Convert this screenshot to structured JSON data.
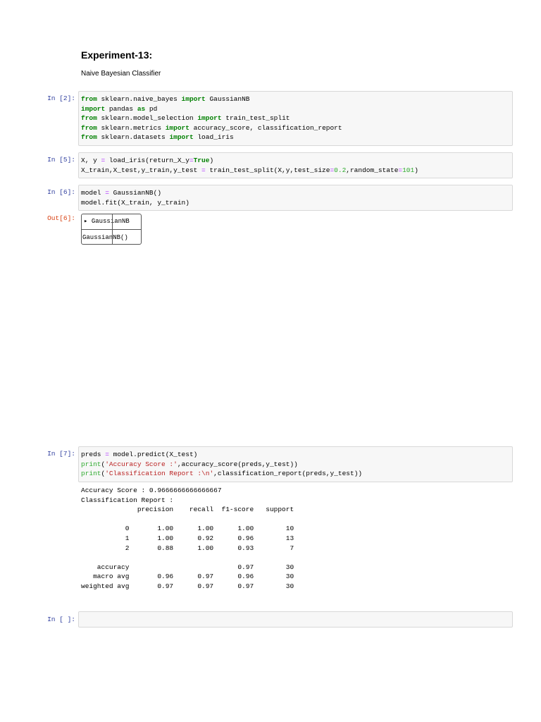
{
  "header": {
    "title": "Experiment-13:",
    "subtitle": "Naive Bayesian Classifier"
  },
  "cells": [
    {
      "prompt": "In [2]:",
      "lines": [
        [
          {
            "t": "from",
            "c": "kw"
          },
          {
            "t": " sklearn.naive_bayes "
          },
          {
            "t": "import",
            "c": "kw"
          },
          {
            "t": " GaussianNB"
          }
        ],
        [
          {
            "t": "import",
            "c": "kw"
          },
          {
            "t": " pandas "
          },
          {
            "t": "as",
            "c": "kw"
          },
          {
            "t": " pd"
          }
        ],
        [
          {
            "t": "from",
            "c": "kw"
          },
          {
            "t": " sklearn.model_selection "
          },
          {
            "t": "import",
            "c": "kw"
          },
          {
            "t": " train_test_split"
          }
        ],
        [
          {
            "t": "from",
            "c": "kw"
          },
          {
            "t": " sklearn.metrics "
          },
          {
            "t": "import",
            "c": "kw"
          },
          {
            "t": " accuracy_score, classification_report"
          }
        ],
        [
          {
            "t": "from",
            "c": "kw"
          },
          {
            "t": " sklearn.datasets "
          },
          {
            "t": "import",
            "c": "kw"
          },
          {
            "t": " load_iris"
          }
        ]
      ]
    },
    {
      "prompt": "In [5]:",
      "lines": [
        [
          {
            "t": "X, y "
          },
          {
            "t": "=",
            "c": "op"
          },
          {
            "t": " load_iris(return_X_y"
          },
          {
            "t": "=",
            "c": "op"
          },
          {
            "t": "True",
            "c": "kw"
          },
          {
            "t": ")"
          }
        ],
        [
          {
            "t": "X_train,X_test,y_train,y_test "
          },
          {
            "t": "=",
            "c": "op"
          },
          {
            "t": " train_test_split(X,y,test_size"
          },
          {
            "t": "=",
            "c": "op"
          },
          {
            "t": "0.2",
            "c": "num"
          },
          {
            "t": ",random_state"
          },
          {
            "t": "=",
            "c": "op"
          },
          {
            "t": "101",
            "c": "num"
          },
          {
            "t": ")"
          }
        ]
      ]
    },
    {
      "prompt": "In [6]:",
      "lines": [
        [
          {
            "t": "model "
          },
          {
            "t": "=",
            "c": "op"
          },
          {
            "t": " GaussianNB()"
          }
        ],
        [
          {
            "t": "model.fit(X_train, y_train)"
          }
        ]
      ]
    },
    {
      "prompt": "In [7]:",
      "lines": [
        [
          {
            "t": "preds "
          },
          {
            "t": "=",
            "c": "op"
          },
          {
            "t": " model.predict(X_test)"
          }
        ],
        [
          {
            "t": "print",
            "c": "num"
          },
          {
            "t": "("
          },
          {
            "t": "'Accuracy Score :'",
            "c": "str"
          },
          {
            "t": ",accuracy_score(preds,y_test))"
          }
        ],
        [
          {
            "t": "print",
            "c": "num"
          },
          {
            "t": "("
          },
          {
            "t": "'Classification Report :\\n'",
            "c": "str"
          },
          {
            "t": ",classification_report(preds,y_test))"
          }
        ]
      ]
    },
    {
      "prompt": "In [ ]:",
      "lines": [
        [
          {
            "t": " "
          }
        ]
      ]
    }
  ],
  "out6": {
    "prompt": "Out[6]:",
    "widget_head": "▸ GaussianNB",
    "widget_foot": "GaussianNB()"
  },
  "out7": {
    "text": "Accuracy Score : 0.9666666666666667\nClassification Report :\n              precision    recall  f1-score   support\n\n           0       1.00      1.00      1.00        10\n           1       1.00      0.92      0.96        13\n           2       0.88      1.00      0.93         7\n\n    accuracy                           0.97        30\n   macro avg       0.96      0.97      0.96        30\nweighted avg       0.97      0.97      0.97        30"
  }
}
